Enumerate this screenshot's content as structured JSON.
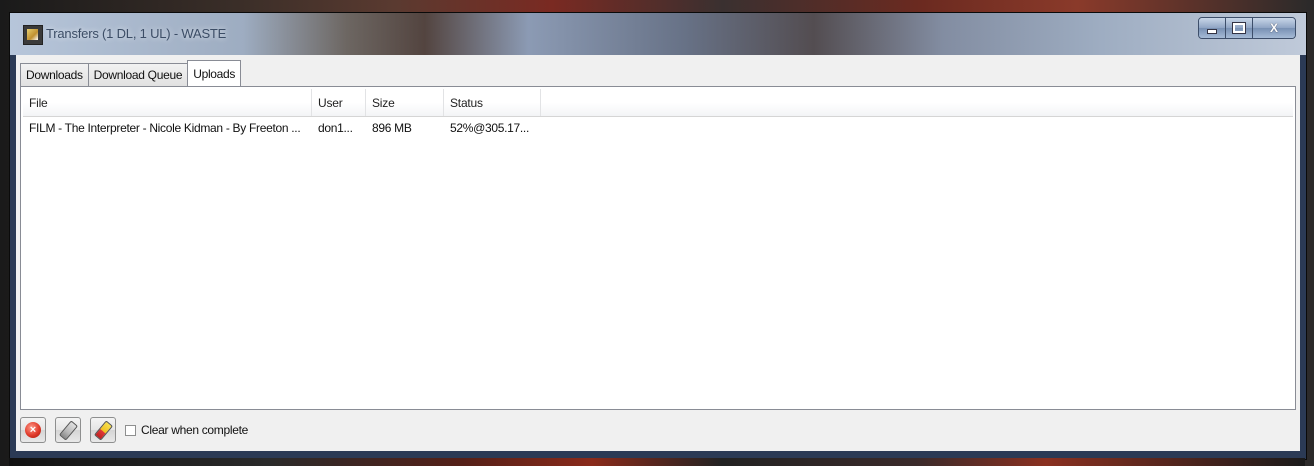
{
  "window": {
    "title": "Transfers (1 DL, 1 UL) - WASTE",
    "icon": "app-icon",
    "controls": {
      "minimize_icon": "minimize-icon",
      "maximize_icon": "maximize-icon",
      "close_label": "X"
    }
  },
  "tabs": [
    {
      "label": "Downloads",
      "active": false
    },
    {
      "label": "Download Queue",
      "active": false
    },
    {
      "label": "Uploads",
      "active": true
    }
  ],
  "list": {
    "columns": [
      "File",
      "User",
      "Size",
      "Status"
    ],
    "rows": [
      {
        "file": "FILM - The Interpreter - Nicole Kidman - By Freeton ...",
        "user": "don1...",
        "size": "896 MB",
        "status": "52%@305.17..."
      }
    ]
  },
  "toolbar": {
    "buttons": [
      {
        "name": "cancel-transfer-button",
        "icon": "cancel-icon"
      },
      {
        "name": "clear-completed-button",
        "icon": "eraser-icon"
      },
      {
        "name": "clear-all-button",
        "icon": "eraser-color-icon"
      }
    ],
    "clear_when_complete": {
      "label": "Clear when complete",
      "checked": false
    }
  },
  "colors": {
    "accent_close": "#c9d6e8",
    "panel_bg": "#ffffff",
    "client_bg": "#f0f0f0"
  }
}
